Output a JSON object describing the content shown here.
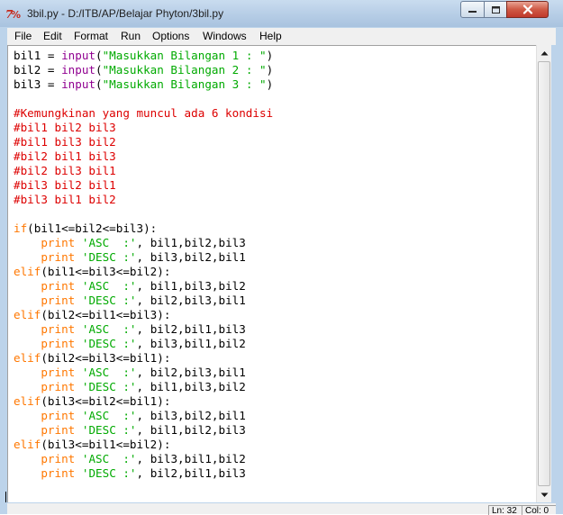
{
  "window": {
    "title": "3bil.py - D:/ITB/AP/Belajar Phyton/3bil.py",
    "app_icon": "idle-python-icon"
  },
  "window_controls": {
    "minimize_icon": "minimize-icon",
    "maximize_icon": "maximize-icon",
    "close_icon": "close-icon"
  },
  "menu": {
    "items": [
      "File",
      "Edit",
      "Format",
      "Run",
      "Options",
      "Windows",
      "Help"
    ]
  },
  "colors": {
    "keyword": "#ff7700",
    "builtin": "#900090",
    "string": "#00aa00",
    "comment": "#dd0000",
    "default": "#000000"
  },
  "code": {
    "lines": [
      [
        [
          "default",
          "bil1 = "
        ],
        [
          "builtin",
          "input"
        ],
        [
          "default",
          "("
        ],
        [
          "string",
          "\"Masukkan Bilangan 1 : \""
        ],
        [
          "default",
          ")"
        ]
      ],
      [
        [
          "default",
          "bil2 = "
        ],
        [
          "builtin",
          "input"
        ],
        [
          "default",
          "("
        ],
        [
          "string",
          "\"Masukkan Bilangan 2 : \""
        ],
        [
          "default",
          ")"
        ]
      ],
      [
        [
          "default",
          "bil3 = "
        ],
        [
          "builtin",
          "input"
        ],
        [
          "default",
          "("
        ],
        [
          "string",
          "\"Masukkan Bilangan 3 : \""
        ],
        [
          "default",
          ")"
        ]
      ],
      [],
      [
        [
          "comment",
          "#Kemungkinan yang muncul ada 6 kondisi"
        ]
      ],
      [
        [
          "comment",
          "#bil1 bil2 bil3"
        ]
      ],
      [
        [
          "comment",
          "#bil1 bil3 bil2"
        ]
      ],
      [
        [
          "comment",
          "#bil2 bil1 bil3"
        ]
      ],
      [
        [
          "comment",
          "#bil2 bil3 bil1"
        ]
      ],
      [
        [
          "comment",
          "#bil3 bil2 bil1"
        ]
      ],
      [
        [
          "comment",
          "#bil3 bil1 bil2"
        ]
      ],
      [],
      [
        [
          "keyword",
          "if"
        ],
        [
          "default",
          "(bil1<=bil2<=bil3):"
        ]
      ],
      [
        [
          "default",
          "    "
        ],
        [
          "keyword",
          "print"
        ],
        [
          "default",
          " "
        ],
        [
          "string",
          "'ASC  :'"
        ],
        [
          "default",
          ", bil1,bil2,bil3"
        ]
      ],
      [
        [
          "default",
          "    "
        ],
        [
          "keyword",
          "print"
        ],
        [
          "default",
          " "
        ],
        [
          "string",
          "'DESC :'"
        ],
        [
          "default",
          ", bil3,bil2,bil1"
        ]
      ],
      [
        [
          "keyword",
          "elif"
        ],
        [
          "default",
          "(bil1<=bil3<=bil2):"
        ]
      ],
      [
        [
          "default",
          "    "
        ],
        [
          "keyword",
          "print"
        ],
        [
          "default",
          " "
        ],
        [
          "string",
          "'ASC  :'"
        ],
        [
          "default",
          ", bil1,bil3,bil2"
        ]
      ],
      [
        [
          "default",
          "    "
        ],
        [
          "keyword",
          "print"
        ],
        [
          "default",
          " "
        ],
        [
          "string",
          "'DESC :'"
        ],
        [
          "default",
          ", bil2,bil3,bil1"
        ]
      ],
      [
        [
          "keyword",
          "elif"
        ],
        [
          "default",
          "(bil2<=bil1<=bil3):"
        ]
      ],
      [
        [
          "default",
          "    "
        ],
        [
          "keyword",
          "print"
        ],
        [
          "default",
          " "
        ],
        [
          "string",
          "'ASC  :'"
        ],
        [
          "default",
          ", bil2,bil1,bil3"
        ]
      ],
      [
        [
          "default",
          "    "
        ],
        [
          "keyword",
          "print"
        ],
        [
          "default",
          " "
        ],
        [
          "string",
          "'DESC :'"
        ],
        [
          "default",
          ", bil3,bil1,bil2"
        ]
      ],
      [
        [
          "keyword",
          "elif"
        ],
        [
          "default",
          "(bil2<=bil3<=bil1):"
        ]
      ],
      [
        [
          "default",
          "    "
        ],
        [
          "keyword",
          "print"
        ],
        [
          "default",
          " "
        ],
        [
          "string",
          "'ASC  :'"
        ],
        [
          "default",
          ", bil2,bil3,bil1"
        ]
      ],
      [
        [
          "default",
          "    "
        ],
        [
          "keyword",
          "print"
        ],
        [
          "default",
          " "
        ],
        [
          "string",
          "'DESC :'"
        ],
        [
          "default",
          ", bil1,bil3,bil2"
        ]
      ],
      [
        [
          "keyword",
          "elif"
        ],
        [
          "default",
          "(bil3<=bil2<=bil1):"
        ]
      ],
      [
        [
          "default",
          "    "
        ],
        [
          "keyword",
          "print"
        ],
        [
          "default",
          " "
        ],
        [
          "string",
          "'ASC  :'"
        ],
        [
          "default",
          ", bil3,bil2,bil1"
        ]
      ],
      [
        [
          "default",
          "    "
        ],
        [
          "keyword",
          "print"
        ],
        [
          "default",
          " "
        ],
        [
          "string",
          "'DESC :'"
        ],
        [
          "default",
          ", bil1,bil2,bil3"
        ]
      ],
      [
        [
          "keyword",
          "elif"
        ],
        [
          "default",
          "(bil3<=bil1<=bil2):"
        ]
      ],
      [
        [
          "default",
          "    "
        ],
        [
          "keyword",
          "print"
        ],
        [
          "default",
          " "
        ],
        [
          "string",
          "'ASC  :'"
        ],
        [
          "default",
          ", bil3,bil1,bil2"
        ]
      ],
      [
        [
          "default",
          "    "
        ],
        [
          "keyword",
          "print"
        ],
        [
          "default",
          " "
        ],
        [
          "string",
          "'DESC :'"
        ],
        [
          "default",
          ", bil2,bil1,bil3"
        ]
      ]
    ]
  },
  "scrollbar": {
    "up_icon": "arrow-up-icon",
    "down_icon": "arrow-down-icon"
  },
  "status": {
    "line": "Ln: 32",
    "col": "Col: 0"
  }
}
